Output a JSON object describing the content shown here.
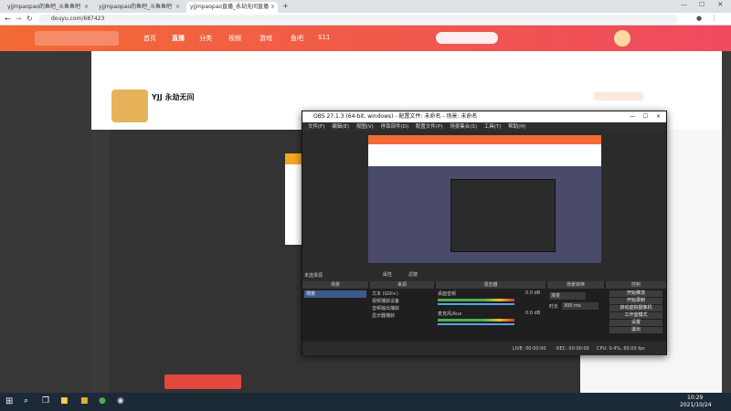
{
  "browser": {
    "tabs": [
      {
        "label": "yjjmpaopao的鱼吧_斗鱼鱼吧"
      },
      {
        "label": "yjjmpaopao的鱼吧_斗鱼鱼吧"
      },
      {
        "label": "yjjmpaopao直播_永劫无间直播"
      }
    ],
    "url": "douyu.com/687423"
  },
  "site": {
    "nav": [
      "首页",
      "直播",
      "分类",
      "视频",
      "游戏",
      "鱼吧",
      "S11"
    ],
    "streamer_name": "YJJ 永劫无间"
  },
  "obs": {
    "title": "OBS 27.1.3 (64-bit, windows) - 配置文件: 未命名 - 场景: 未命名",
    "menu": [
      "文件(F)",
      "编辑(E)",
      "视图(V)",
      "停靠部件(D)",
      "配置文件(P)",
      "场景集合(S)",
      "工具(T)",
      "帮助(H)"
    ],
    "no_source": "未选择源",
    "btn_props": "属性",
    "btn_filters": "滤镜",
    "docks": {
      "scenes": "场景",
      "sources": "来源",
      "mixer": "混音器",
      "transitions": "场景转换",
      "controls": "控制"
    },
    "scene_name": "场景",
    "sources": [
      "文本 (GDI+)",
      "视频捕获设备",
      "音频输出捕获",
      "显示器捕获"
    ],
    "mixer_tracks": [
      {
        "name": "桌面音频",
        "db": "0.0 dB"
      },
      {
        "name": "麦克风/Aux",
        "db": "0.0 dB"
      }
    ],
    "transition": {
      "type": "渐变",
      "duration_label": "时长",
      "duration": "300 ms"
    },
    "controls": [
      "开始推流",
      "开始录制",
      "启动虚拟摄像机",
      "工作室模式",
      "设置",
      "退出"
    ],
    "status": {
      "live": "LIVE: 00:00:00",
      "rec": "REC: 00:00:00",
      "cpu": "CPU: 0.4%, 60.00 fps"
    }
  },
  "taskbar": {
    "time": "10:29",
    "date": "2021/10/24"
  },
  "colors": {
    "accent": "#f26a34",
    "obs_bg": "#2b2b2b"
  }
}
